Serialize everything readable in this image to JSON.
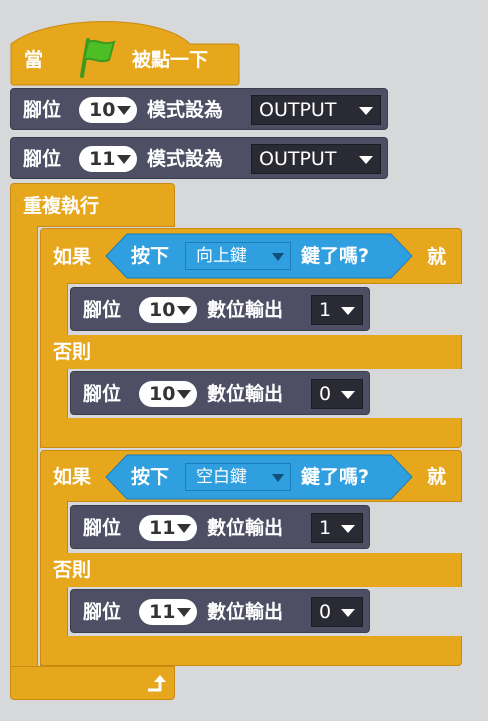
{
  "hat": {
    "when_label": "當",
    "clicked_label": "被點一下"
  },
  "pin_label": "腳位",
  "pin_mode": [
    {
      "pin": "10",
      "mode_label": "模式設為",
      "mode": "OUTPUT"
    },
    {
      "pin": "11",
      "mode_label": "模式設為",
      "mode": "OUTPUT"
    }
  ],
  "forever_label": "重複執行",
  "if_blocks": [
    {
      "if_label": "如果",
      "then_label": "就",
      "pressed_label": "按下",
      "key": "向上鍵",
      "key_q_label": "鍵了嗎?",
      "then_pin": "10",
      "then_value": "1",
      "else_label": "否則",
      "else_pin": "10",
      "else_value": "0"
    },
    {
      "if_label": "如果",
      "then_label": "就",
      "pressed_label": "按下",
      "key": "空白鍵",
      "key_q_label": "鍵了嗎?",
      "then_pin": "11",
      "then_value": "1",
      "else_label": "否則",
      "else_pin": "11",
      "else_value": "0"
    }
  ],
  "digital_out_label": "數位輸出",
  "colors": {
    "event": "#e6a71d",
    "control": "#e6a71d",
    "pin": "#4e4f64",
    "sensing": "#2f9fdf",
    "flag": "#4cbf26"
  }
}
